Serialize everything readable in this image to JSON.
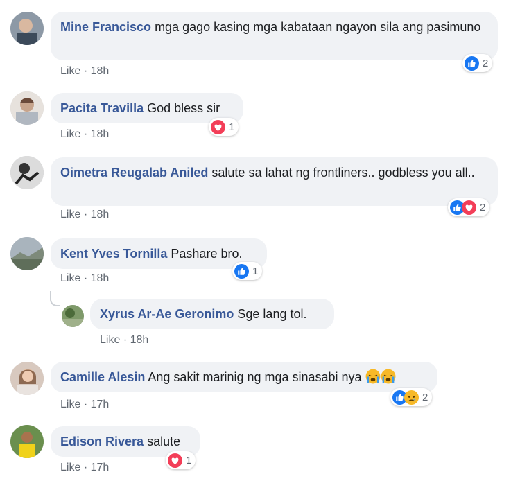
{
  "comments": [
    {
      "name": "Mine Francisco",
      "text": "mga gago kasing mga kabataan ngayon sila ang pasimuno",
      "like": "Like",
      "time": "18h",
      "reactions": [
        "like-icon"
      ],
      "count": "2"
    },
    {
      "name": "Pacita Travilla",
      "text": "God bless sir",
      "like": "Like",
      "time": "18h",
      "reactions": [
        "love-icon"
      ],
      "count": "1"
    },
    {
      "name": "Oimetra Reugalab Aniled",
      "text": "salute sa lahat ng frontliners.. godbless you all..",
      "like": "Like",
      "time": "18h",
      "reactions": [
        "like-icon",
        "love-icon"
      ],
      "count": "2"
    },
    {
      "name": "Kent Yves Tornilla",
      "text": "Pashare bro.",
      "like": "Like",
      "time": "18h",
      "reactions": [
        "like-icon"
      ],
      "count": "1"
    },
    {
      "name": "Xyrus Ar-Ae Geronimo",
      "text": "Sge lang tol.",
      "like": "Like",
      "time": "18h"
    },
    {
      "name": "Camille Alesin",
      "text": "Ang sakit marinig ng mga sinasabi nya",
      "like": "Like",
      "time": "17h",
      "emojis": [
        "crying-face-icon",
        "crying-face-icon"
      ],
      "reactions": [
        "like-icon",
        "sad-icon"
      ],
      "count": "2"
    },
    {
      "name": "Edison Rivera",
      "text": "salute",
      "like": "Like",
      "time": "17h",
      "reactions": [
        "love-icon"
      ],
      "count": "1"
    }
  ],
  "separator": "·",
  "colors": {
    "name": "#385898",
    "bubble": "#f0f2f5",
    "like_blue": "#1877f2",
    "love_red": "#f33e58",
    "sad_yellow": "#f7b928"
  }
}
